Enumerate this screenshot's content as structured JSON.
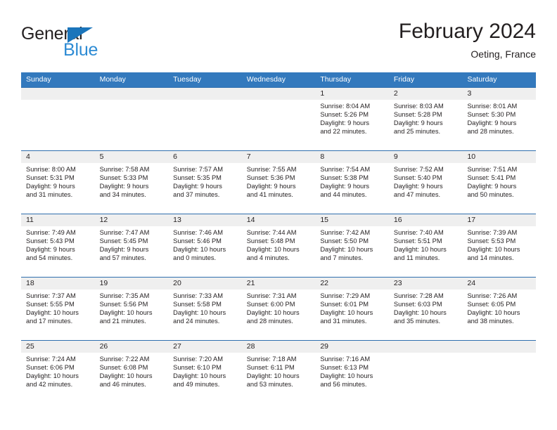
{
  "brand": {
    "name_part1": "General",
    "name_part2": "Blue",
    "triangle_color": "#1b75bb",
    "blue_color": "#2d8bd4"
  },
  "header": {
    "title": "February 2024",
    "subtitle": "Oeting, France"
  },
  "theme": {
    "header_blue": "#3379bd",
    "row_divider_blue": "#2f6fae",
    "day_band_gray": "#efefef"
  },
  "weekday_headers": [
    "Sunday",
    "Monday",
    "Tuesday",
    "Wednesday",
    "Thursday",
    "Friday",
    "Saturday"
  ],
  "labels": {
    "sunrise_prefix": "Sunrise:",
    "sunset_prefix": "Sunset:",
    "daylight_prefix": "Daylight:"
  },
  "weeks": [
    [
      {
        "day": "",
        "empty": true
      },
      {
        "day": "",
        "empty": true
      },
      {
        "day": "",
        "empty": true
      },
      {
        "day": "",
        "empty": true
      },
      {
        "day": "1",
        "sunrise": "Sunrise: 8:04 AM",
        "sunset": "Sunset: 5:26 PM",
        "daylight_line1": "Daylight: 9 hours",
        "daylight_line2": "and 22 minutes."
      },
      {
        "day": "2",
        "sunrise": "Sunrise: 8:03 AM",
        "sunset": "Sunset: 5:28 PM",
        "daylight_line1": "Daylight: 9 hours",
        "daylight_line2": "and 25 minutes."
      },
      {
        "day": "3",
        "sunrise": "Sunrise: 8:01 AM",
        "sunset": "Sunset: 5:30 PM",
        "daylight_line1": "Daylight: 9 hours",
        "daylight_line2": "and 28 minutes."
      }
    ],
    [
      {
        "day": "4",
        "sunrise": "Sunrise: 8:00 AM",
        "sunset": "Sunset: 5:31 PM",
        "daylight_line1": "Daylight: 9 hours",
        "daylight_line2": "and 31 minutes."
      },
      {
        "day": "5",
        "sunrise": "Sunrise: 7:58 AM",
        "sunset": "Sunset: 5:33 PM",
        "daylight_line1": "Daylight: 9 hours",
        "daylight_line2": "and 34 minutes."
      },
      {
        "day": "6",
        "sunrise": "Sunrise: 7:57 AM",
        "sunset": "Sunset: 5:35 PM",
        "daylight_line1": "Daylight: 9 hours",
        "daylight_line2": "and 37 minutes."
      },
      {
        "day": "7",
        "sunrise": "Sunrise: 7:55 AM",
        "sunset": "Sunset: 5:36 PM",
        "daylight_line1": "Daylight: 9 hours",
        "daylight_line2": "and 41 minutes."
      },
      {
        "day": "8",
        "sunrise": "Sunrise: 7:54 AM",
        "sunset": "Sunset: 5:38 PM",
        "daylight_line1": "Daylight: 9 hours",
        "daylight_line2": "and 44 minutes."
      },
      {
        "day": "9",
        "sunrise": "Sunrise: 7:52 AM",
        "sunset": "Sunset: 5:40 PM",
        "daylight_line1": "Daylight: 9 hours",
        "daylight_line2": "and 47 minutes."
      },
      {
        "day": "10",
        "sunrise": "Sunrise: 7:51 AM",
        "sunset": "Sunset: 5:41 PM",
        "daylight_line1": "Daylight: 9 hours",
        "daylight_line2": "and 50 minutes."
      }
    ],
    [
      {
        "day": "11",
        "sunrise": "Sunrise: 7:49 AM",
        "sunset": "Sunset: 5:43 PM",
        "daylight_line1": "Daylight: 9 hours",
        "daylight_line2": "and 54 minutes."
      },
      {
        "day": "12",
        "sunrise": "Sunrise: 7:47 AM",
        "sunset": "Sunset: 5:45 PM",
        "daylight_line1": "Daylight: 9 hours",
        "daylight_line2": "and 57 minutes."
      },
      {
        "day": "13",
        "sunrise": "Sunrise: 7:46 AM",
        "sunset": "Sunset: 5:46 PM",
        "daylight_line1": "Daylight: 10 hours",
        "daylight_line2": "and 0 minutes."
      },
      {
        "day": "14",
        "sunrise": "Sunrise: 7:44 AM",
        "sunset": "Sunset: 5:48 PM",
        "daylight_line1": "Daylight: 10 hours",
        "daylight_line2": "and 4 minutes."
      },
      {
        "day": "15",
        "sunrise": "Sunrise: 7:42 AM",
        "sunset": "Sunset: 5:50 PM",
        "daylight_line1": "Daylight: 10 hours",
        "daylight_line2": "and 7 minutes."
      },
      {
        "day": "16",
        "sunrise": "Sunrise: 7:40 AM",
        "sunset": "Sunset: 5:51 PM",
        "daylight_line1": "Daylight: 10 hours",
        "daylight_line2": "and 11 minutes."
      },
      {
        "day": "17",
        "sunrise": "Sunrise: 7:39 AM",
        "sunset": "Sunset: 5:53 PM",
        "daylight_line1": "Daylight: 10 hours",
        "daylight_line2": "and 14 minutes."
      }
    ],
    [
      {
        "day": "18",
        "sunrise": "Sunrise: 7:37 AM",
        "sunset": "Sunset: 5:55 PM",
        "daylight_line1": "Daylight: 10 hours",
        "daylight_line2": "and 17 minutes."
      },
      {
        "day": "19",
        "sunrise": "Sunrise: 7:35 AM",
        "sunset": "Sunset: 5:56 PM",
        "daylight_line1": "Daylight: 10 hours",
        "daylight_line2": "and 21 minutes."
      },
      {
        "day": "20",
        "sunrise": "Sunrise: 7:33 AM",
        "sunset": "Sunset: 5:58 PM",
        "daylight_line1": "Daylight: 10 hours",
        "daylight_line2": "and 24 minutes."
      },
      {
        "day": "21",
        "sunrise": "Sunrise: 7:31 AM",
        "sunset": "Sunset: 6:00 PM",
        "daylight_line1": "Daylight: 10 hours",
        "daylight_line2": "and 28 minutes."
      },
      {
        "day": "22",
        "sunrise": "Sunrise: 7:29 AM",
        "sunset": "Sunset: 6:01 PM",
        "daylight_line1": "Daylight: 10 hours",
        "daylight_line2": "and 31 minutes."
      },
      {
        "day": "23",
        "sunrise": "Sunrise: 7:28 AM",
        "sunset": "Sunset: 6:03 PM",
        "daylight_line1": "Daylight: 10 hours",
        "daylight_line2": "and 35 minutes."
      },
      {
        "day": "24",
        "sunrise": "Sunrise: 7:26 AM",
        "sunset": "Sunset: 6:05 PM",
        "daylight_line1": "Daylight: 10 hours",
        "daylight_line2": "and 38 minutes."
      }
    ],
    [
      {
        "day": "25",
        "sunrise": "Sunrise: 7:24 AM",
        "sunset": "Sunset: 6:06 PM",
        "daylight_line1": "Daylight: 10 hours",
        "daylight_line2": "and 42 minutes."
      },
      {
        "day": "26",
        "sunrise": "Sunrise: 7:22 AM",
        "sunset": "Sunset: 6:08 PM",
        "daylight_line1": "Daylight: 10 hours",
        "daylight_line2": "and 46 minutes."
      },
      {
        "day": "27",
        "sunrise": "Sunrise: 7:20 AM",
        "sunset": "Sunset: 6:10 PM",
        "daylight_line1": "Daylight: 10 hours",
        "daylight_line2": "and 49 minutes."
      },
      {
        "day": "28",
        "sunrise": "Sunrise: 7:18 AM",
        "sunset": "Sunset: 6:11 PM",
        "daylight_line1": "Daylight: 10 hours",
        "daylight_line2": "and 53 minutes."
      },
      {
        "day": "29",
        "sunrise": "Sunrise: 7:16 AM",
        "sunset": "Sunset: 6:13 PM",
        "daylight_line1": "Daylight: 10 hours",
        "daylight_line2": "and 56 minutes."
      },
      {
        "day": "",
        "empty": true
      },
      {
        "day": "",
        "empty": true
      }
    ]
  ]
}
